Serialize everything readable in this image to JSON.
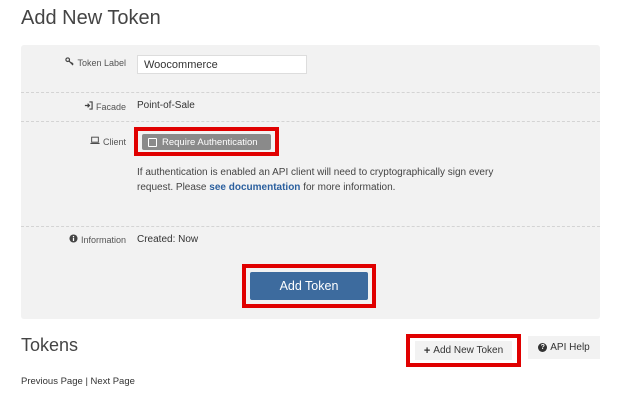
{
  "page": {
    "title": "Add New Token"
  },
  "form": {
    "token_label": {
      "label": "Token Label",
      "icon": "key-icon",
      "value": "Woocommerce"
    },
    "facade": {
      "label": "Facade",
      "icon": "sign-in-icon",
      "value": "Point-of-Sale"
    },
    "client": {
      "label": "Client",
      "icon": "laptop-icon",
      "require_auth_label": "Require Authentication",
      "help_before": "If authentication is enabled an API client will need to cryptographically sign every request. Please",
      "help_link": "see documentation",
      "help_after": "for more information."
    },
    "information": {
      "label": "Information",
      "icon": "info-circle-icon",
      "value": "Created: Now"
    },
    "submit_label": "Add Token"
  },
  "tokens": {
    "title": "Tokens",
    "add_new_label": "Add New Token",
    "api_help_label": "API Help",
    "pager": {
      "previous": "Previous Page",
      "separator": "|",
      "next": "Next Page"
    }
  },
  "colors": {
    "highlight": "#e00000",
    "primary_button": "#3d6b9e",
    "panel_bg": "#f2f2f2",
    "link": "#2a5f9e"
  }
}
